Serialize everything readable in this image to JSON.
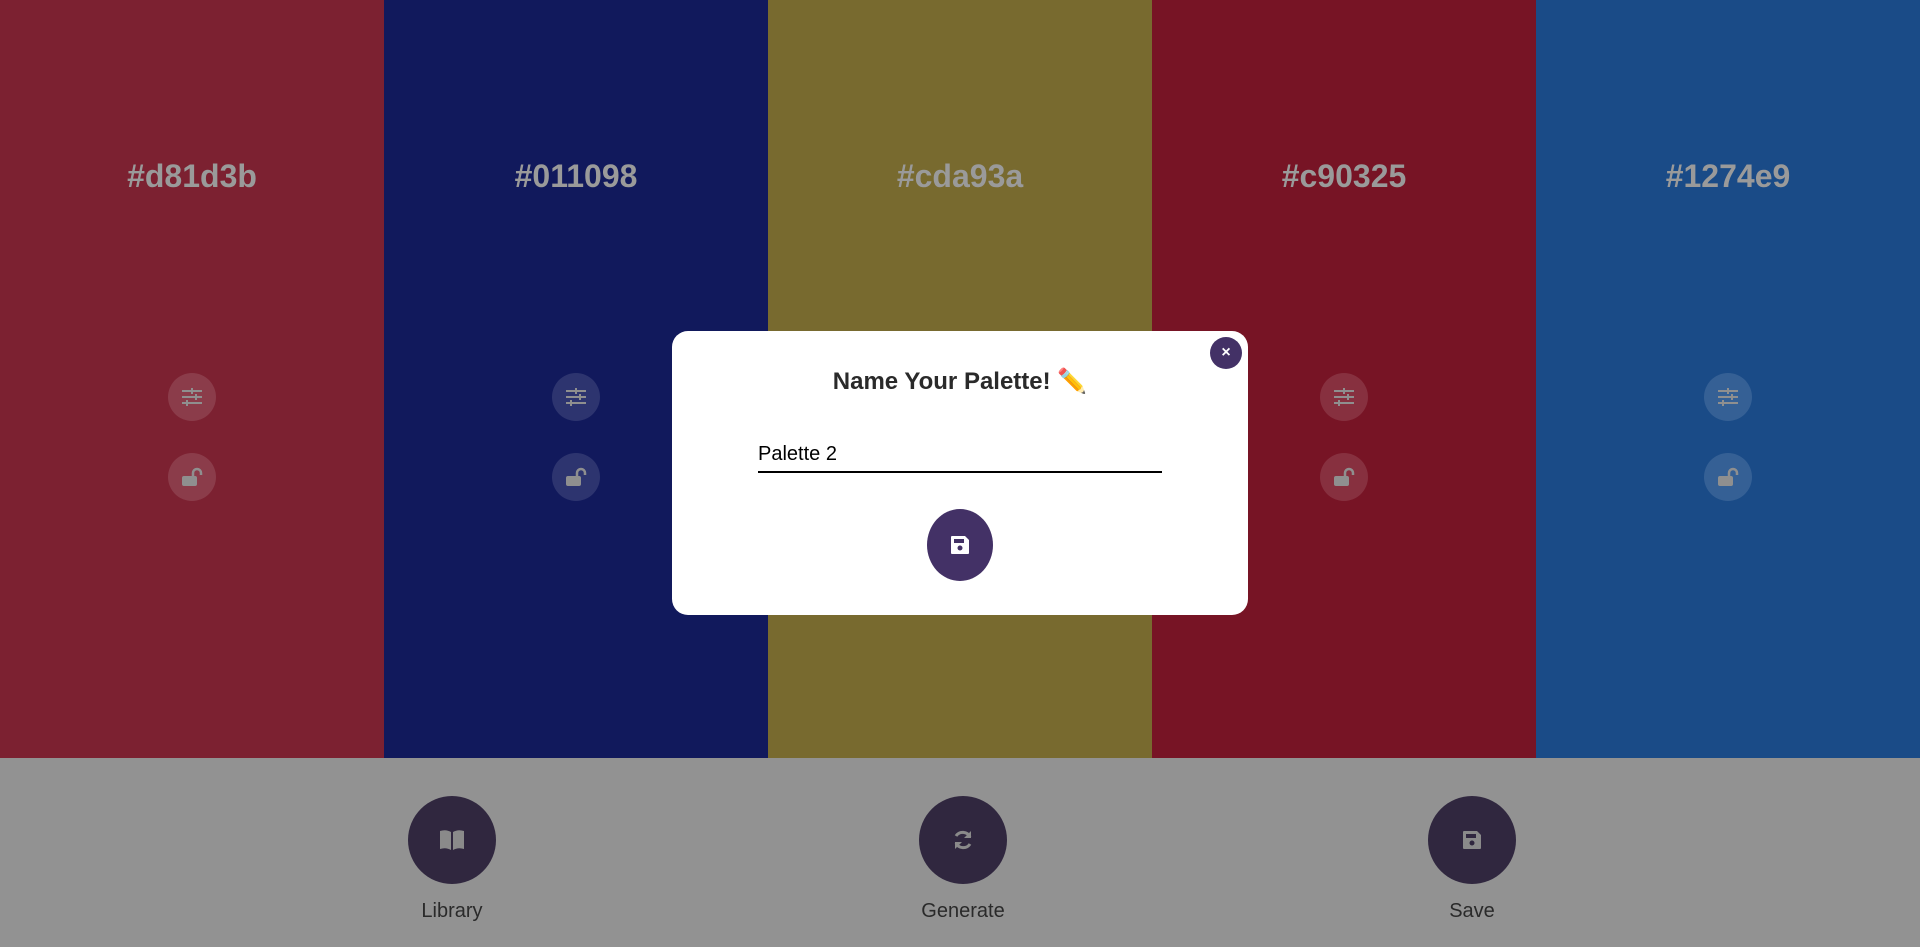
{
  "columns": [
    {
      "hex": "#d81d3b",
      "display_color": "#7c2131"
    },
    {
      "hex": "#011098",
      "display_color": "#11195c"
    },
    {
      "hex": "#cda93a",
      "display_color": "#786a2f"
    },
    {
      "hex": "#c90325",
      "display_color": "#771425"
    },
    {
      "hex": "#1274e9",
      "display_color": "#1a4b87"
    }
  ],
  "column_icons": {
    "adjust": "sliders-icon",
    "lock": "unlock-icon"
  },
  "toolbar": {
    "library_label": "Library",
    "library_icon": "book-open-icon",
    "generate_label": "Generate",
    "generate_icon": "refresh-icon",
    "save_label": "Save",
    "save_icon": "floppy-disk-icon"
  },
  "modal": {
    "title": "Name Your Palette!",
    "title_emoji": "✏️",
    "close_label": "×",
    "input_value": "Palette 2",
    "save_icon": "floppy-disk-icon",
    "accent": "#433166"
  }
}
